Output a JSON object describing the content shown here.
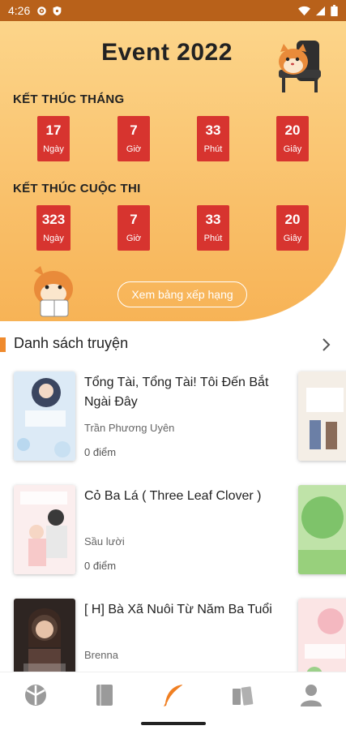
{
  "statusbar": {
    "time": "4:26",
    "icons": [
      "gear-icon",
      "shield-icon",
      "wifi-icon",
      "signal-icon",
      "battery-icon"
    ]
  },
  "event": {
    "title": "Event 2022",
    "month_label": "KẾT THÚC THÁNG",
    "month_countdown": [
      {
        "value": "17",
        "unit": "Ngày"
      },
      {
        "value": "7",
        "unit": "Giờ"
      },
      {
        "value": "33",
        "unit": "Phút"
      },
      {
        "value": "20",
        "unit": "Giây"
      }
    ],
    "contest_label": "KẾT THÚC CUỘC THI",
    "contest_countdown": [
      {
        "value": "323",
        "unit": "Ngày"
      },
      {
        "value": "7",
        "unit": "Giờ"
      },
      {
        "value": "33",
        "unit": "Phút"
      },
      {
        "value": "20",
        "unit": "Giây"
      }
    ],
    "ranking_button": "Xem bảng xếp hạng"
  },
  "list": {
    "title": "Danh sách truyện",
    "stories": [
      {
        "title": "Tổng Tài, Tổng Tài! Tôi Đến Bắt Ngài Đây",
        "author": "Trần Phương Uyên",
        "score": "0 điểm"
      },
      {
        "title": "Cỏ Ba Lá ( Three Leaf Clover )",
        "author": "Sầu lười",
        "score": "0 điểm"
      },
      {
        "title": "[ H]  Bà Xã Nuôi Từ Năm Ba Tuổi",
        "author": "Brenna",
        "score": ""
      }
    ]
  },
  "colors": {
    "statusbar": "#b8611a",
    "accent": "#ef8a2d",
    "countdown_box": "#d7342f",
    "banner": "#f9c06a"
  },
  "bottom_nav": {
    "icons": [
      "home-icon",
      "book-icon",
      "quill-icon",
      "library-icon",
      "profile-icon"
    ],
    "active": "quill-icon"
  }
}
